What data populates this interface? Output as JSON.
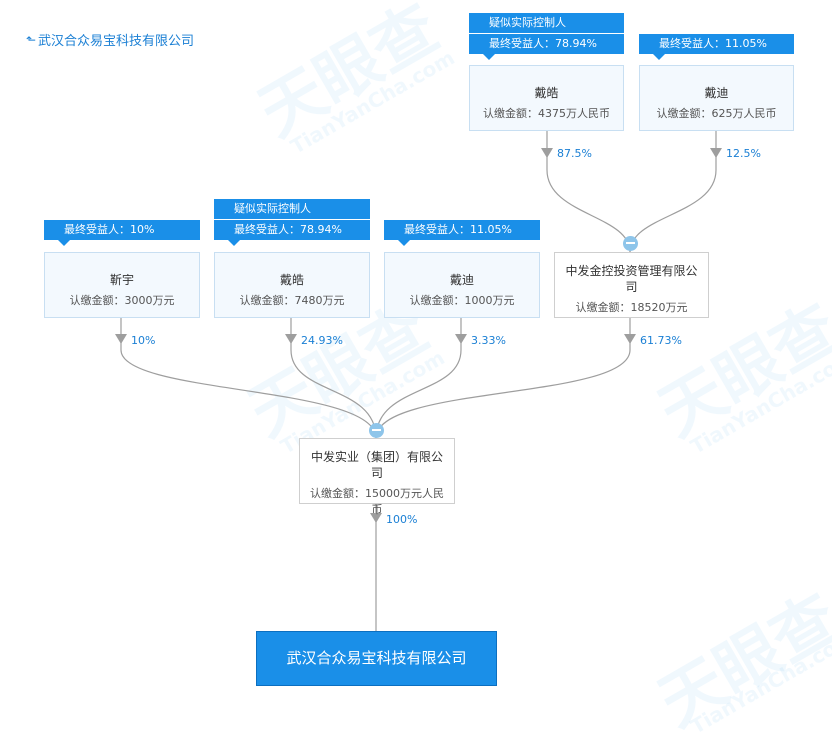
{
  "header": {
    "back_label": "武汉合众易宝科技有限公司"
  },
  "watermark": {
    "big": "天眼查",
    "small": "TianYanCha.com"
  },
  "nodes": {
    "dai_hao_top": {
      "name": "戴皓",
      "amount": "认缴金额：4375万人民币",
      "tag_sub": "疑似实际控制人",
      "tag": "最终受益人：78.94%"
    },
    "dai_di_top": {
      "name": "戴迪",
      "amount": "认缴金额：625万人民币",
      "tag": "最终受益人：11.05%"
    },
    "jin_yu": {
      "name": "靳宇",
      "amount": "认缴金额：3000万元",
      "tag": "最终受益人：10%"
    },
    "dai_hao": {
      "name": "戴皓",
      "amount": "认缴金额：7480万元",
      "tag_sub": "疑似实际控制人",
      "tag": "最终受益人：78.94%"
    },
    "dai_di": {
      "name": "戴迪",
      "amount": "认缴金额：1000万元",
      "tag": "最终受益人：11.05%"
    },
    "zhongfa_jinkong": {
      "name": "中发金控投资管理有限公司",
      "amount": "认缴金额：18520万元"
    },
    "zhongfa_shiye": {
      "name": "中发实业（集团）有限公司",
      "amount": "认缴金额：15000万元人民币"
    },
    "target": {
      "name": "武汉合众易宝科技有限公司"
    }
  },
  "percentages": {
    "dai_hao_top": "87.5%",
    "dai_di_top": "12.5%",
    "jin_yu": "10%",
    "dai_hao": "24.93%",
    "dai_di": "3.33%",
    "zhongfa_jinkong": "61.73%",
    "zhongfa_shiye": "100%"
  },
  "colors": {
    "accent": "#1a8fe8",
    "link": "#1a7fd4",
    "line": "#9e9e9e"
  }
}
